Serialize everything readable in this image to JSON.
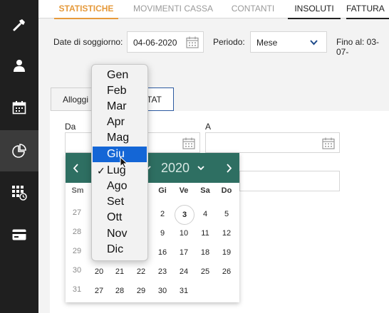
{
  "tabs": [
    {
      "label": "STATISTICHE",
      "state": "active"
    },
    {
      "label": "MOVIMENTI CASSA",
      "state": ""
    },
    {
      "label": "CONTANTI",
      "state": ""
    },
    {
      "label": "INSOLUTI",
      "state": "dark"
    },
    {
      "label": "FATTURA",
      "state": "dark"
    }
  ],
  "sidebar": {
    "items": [
      {
        "icon": "tools-icon"
      },
      {
        "icon": "user-icon"
      },
      {
        "icon": "calendar-icon"
      },
      {
        "icon": "pie-chart-icon",
        "active": true
      },
      {
        "icon": "calendar-grid-icon"
      },
      {
        "icon": "credit-card-icon"
      }
    ]
  },
  "filters": {
    "stay_date_label": "Date di soggiorno:",
    "stay_date_value": "04-06-2020",
    "period_label": "Periodo:",
    "period_value": "Mese",
    "until_label": "Fino al: 03-07-"
  },
  "inner_tabs": {
    "first": "Alloggi",
    "second": "TAT"
  },
  "form": {
    "from_label": "Da",
    "to_label": "A"
  },
  "calendar": {
    "year": "2020",
    "weekdays_visible": [
      "Sm",
      "Gi",
      "Ve",
      "Sa",
      "Do"
    ],
    "weeks": [
      "27",
      "28",
      "29",
      "30",
      "31"
    ],
    "rows": [
      [
        "",
        "",
        "",
        "2",
        "3",
        "4",
        "5"
      ],
      [
        "",
        "",
        "",
        "9",
        "10",
        "11",
        "12"
      ],
      [
        "",
        "",
        "",
        "16",
        "17",
        "18",
        "19"
      ],
      [
        "20",
        "21",
        "22",
        "23",
        "24",
        "25",
        "26"
      ],
      [
        "27",
        "28",
        "29",
        "30",
        "31",
        "",
        ""
      ]
    ],
    "today": "3"
  },
  "month_dropdown": {
    "options": [
      "Gen",
      "Feb",
      "Mar",
      "Apr",
      "Mag",
      "Giu",
      "Lug",
      "Ago",
      "Set",
      "Ott",
      "Nov",
      "Dic"
    ],
    "highlighted": "Giu",
    "checked": "Lug"
  },
  "colors": {
    "accent": "#e69a3b",
    "calendar_header": "#2e6f62",
    "selection": "#1466d6",
    "sidebar": "#1f1f1f"
  }
}
